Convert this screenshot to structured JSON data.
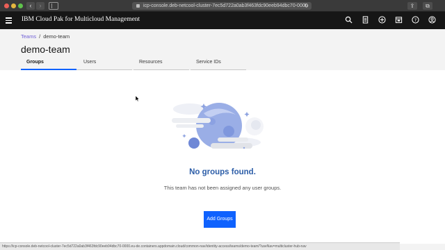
{
  "browser": {
    "url": "icp-console.deb-netcool-cluster-7ec5d722a0ab3f463fdc90eeb94dbc70-0000",
    "back_icon": "chevron-left-icon",
    "forward_icon": "chevron-right-icon"
  },
  "app": {
    "title": "IBM Cloud Pak for Multicloud Management",
    "header_icons": [
      "search-icon",
      "catalog-icon",
      "add-icon",
      "calendar-icon",
      "help-icon",
      "user-icon"
    ]
  },
  "breadcrumb": {
    "parent": "Teams",
    "separator": "/",
    "current": "demo-team"
  },
  "page": {
    "title": "demo-team"
  },
  "tabs": [
    {
      "label": "Groups",
      "active": true
    },
    {
      "label": "Users",
      "active": false
    },
    {
      "label": "Resources",
      "active": false
    },
    {
      "label": "Service IDs",
      "active": false
    }
  ],
  "empty_state": {
    "title": "No groups found.",
    "description": "This team has not been assigned any user groups.",
    "button_label": "Add Groups"
  },
  "status_bar": {
    "text": "https://icp-console.deb-netcool-cluster-7ec5d722a0ab3f463fdc90eeb94dbc70-0000.eu-de.containers.appdomain.cloud/common-nav/identity-access/teams/demo-team/?useNav=multicluster-hub-nav"
  },
  "colors": {
    "accent": "#0f62fe",
    "link": "#6f5fd6",
    "header_bg": "#161616",
    "empty_title": "#2d5ea8"
  }
}
